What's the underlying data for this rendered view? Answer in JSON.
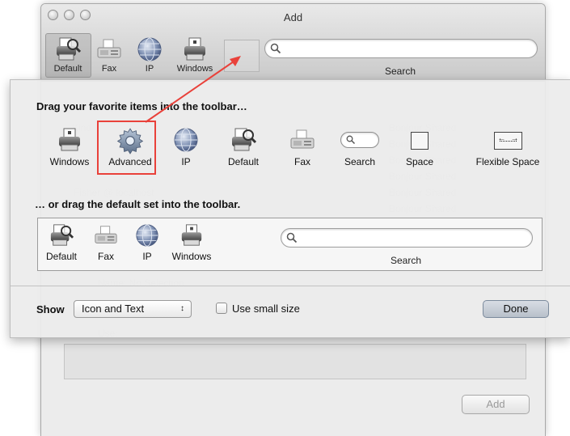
{
  "window": {
    "title": "Add",
    "toolbar": [
      {
        "label": "Default",
        "icon": "printer-magnifier-icon"
      },
      {
        "label": "Fax",
        "icon": "fax-icon"
      },
      {
        "label": "IP",
        "icon": "globe-icon"
      },
      {
        "label": "Windows",
        "icon": "printer-icon"
      }
    ],
    "search_label": "Search",
    "add_button": "Add"
  },
  "sheet": {
    "heading_palette": "Drag your favorite items into the toolbar…",
    "palette": [
      {
        "label": "Windows",
        "icon": "printer-icon"
      },
      {
        "label": "Advanced",
        "icon": "gear-icon"
      },
      {
        "label": "IP",
        "icon": "globe-icon"
      },
      {
        "label": "Default",
        "icon": "printer-magnifier-icon"
      },
      {
        "label": "Fax",
        "icon": "fax-icon"
      },
      {
        "label": "Search",
        "icon": "search-field-icon"
      },
      {
        "label": "Space",
        "icon": "space-icon"
      },
      {
        "label": "Flexible Space",
        "icon": "flexible-space-icon"
      }
    ],
    "heading_default": "… or drag the default set into the toolbar.",
    "default_set": [
      {
        "label": "Default"
      },
      {
        "label": "Fax"
      },
      {
        "label": "IP"
      },
      {
        "label": "Windows"
      }
    ],
    "default_search_label": "Search",
    "show_label": "Show",
    "show_value": "Icon and Text",
    "small_size_label": "Use small size",
    "done_label": "Done"
  },
  "colors": {
    "callout": "#e9413a",
    "done_button": "#b8c0ca"
  }
}
